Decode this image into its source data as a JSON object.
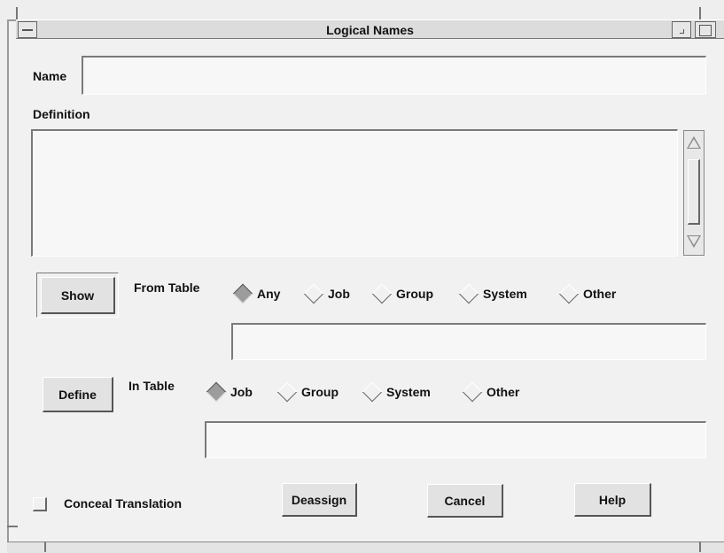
{
  "window": {
    "title": "Logical Names"
  },
  "name_field": {
    "label": "Name",
    "value": ""
  },
  "definition": {
    "label": "Definition",
    "value": ""
  },
  "show": {
    "button_label": "Show",
    "from_table_label": "From Table",
    "options": [
      "Any",
      "Job",
      "Group",
      "System",
      "Other"
    ],
    "selected": "Any",
    "table_value": ""
  },
  "define": {
    "button_label": "Define",
    "in_table_label": "In Table",
    "options": [
      "Job",
      "Group",
      "System",
      "Other"
    ],
    "selected": "Job",
    "table_value": ""
  },
  "footer": {
    "conceal_label": "Conceal Translation",
    "conceal_checked": false,
    "deassign_label": "Deassign",
    "cancel_label": "Cancel",
    "help_label": "Help"
  },
  "icons": [
    "window-menu-icon",
    "minimize-icon",
    "maximize-icon",
    "scroll-up-icon",
    "scroll-down-icon",
    "radio-diamond-icon"
  ],
  "colors": {
    "background": "#f1f1f1",
    "radio_selected": "#9c9c9c",
    "bevel_dark": "#555555"
  }
}
